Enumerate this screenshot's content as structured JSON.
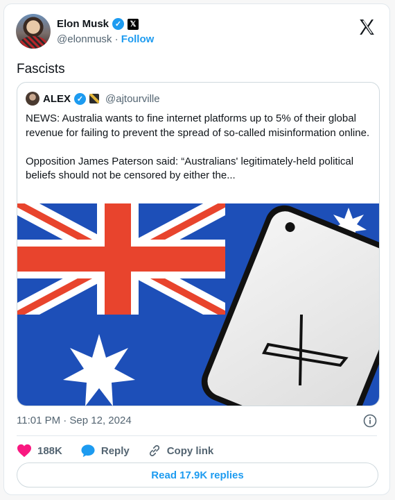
{
  "author": {
    "display_name": "Elon Musk",
    "handle": "@elonmusk",
    "separator": "·",
    "follow_label": "Follow"
  },
  "tweet": {
    "text": "Fascists",
    "timestamp": "11:01 PM · Sep 12, 2024"
  },
  "quoted": {
    "display_name": "ALEX",
    "handle": "@ajtourville",
    "body": "NEWS: Australia wants to fine internet platforms up to 5% of their global revenue for failing to prevent the spread of so-called misinformation online.\n\nOpposition James Paterson said: “Australians' legitimately-held political beliefs should not be censored by either the..."
  },
  "actions": {
    "like_count": "188K",
    "reply_label": "Reply",
    "copy_link_label": "Copy link"
  },
  "read_replies_label": "Read 17.9K replies",
  "icons": {
    "verified": "verified-badge-icon",
    "x_logo": "x-logo-icon",
    "info": "info-icon",
    "heart": "heart-icon",
    "reply": "reply-bubble-icon",
    "link": "link-icon"
  },
  "colors": {
    "accent": "#1d9bf0",
    "like": "#f91880",
    "text_secondary": "#536471"
  }
}
